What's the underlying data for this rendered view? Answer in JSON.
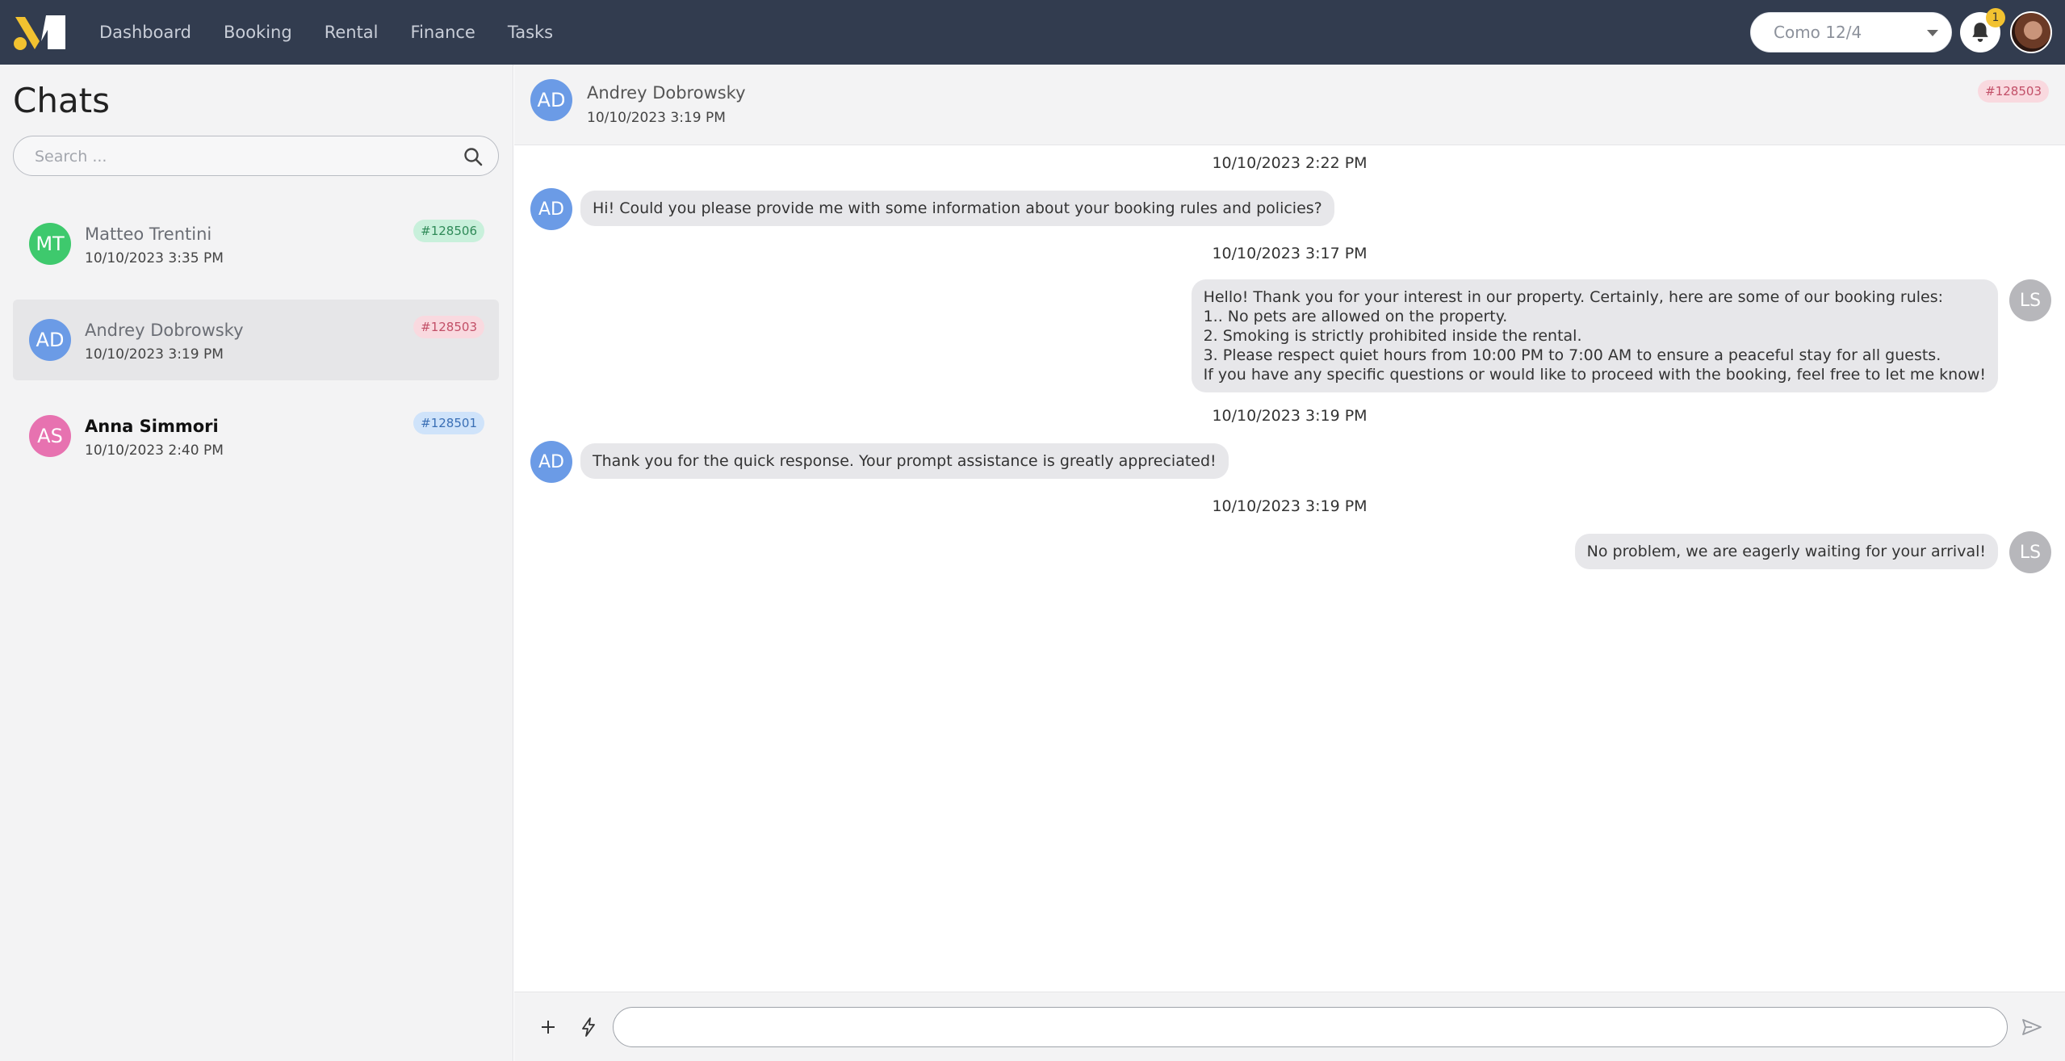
{
  "nav": {
    "items": [
      "Dashboard",
      "Booking",
      "Rental",
      "Finance",
      "Tasks"
    ]
  },
  "header_right": {
    "location_select": "Como 12/4",
    "notification_count": "1"
  },
  "sidebar": {
    "title": "Chats",
    "search_placeholder": "Search ...",
    "chats": [
      {
        "initials": "MT",
        "name": "Matteo Trentini",
        "time": "10/10/2023 3:35 PM",
        "tag": "#128506",
        "avatar_color": "#3ec96d",
        "tag_bg": "#c8f0db",
        "tag_fg": "#2f8a58",
        "active": false,
        "unread": false
      },
      {
        "initials": "AD",
        "name": "Andrey Dobrowsky",
        "time": "10/10/2023 3:19 PM",
        "tag": "#128503",
        "avatar_color": "#6b9be6",
        "tag_bg": "#f9d9df",
        "tag_fg": "#c24f67",
        "active": true,
        "unread": false
      },
      {
        "initials": "AS",
        "name": "Anna Simmori",
        "time": "10/10/2023 2:40 PM",
        "tag": "#128501",
        "avatar_color": "#e772b0",
        "tag_bg": "#cfe3fa",
        "tag_fg": "#3a6fb5",
        "active": false,
        "unread": true
      }
    ]
  },
  "chat": {
    "contact_initials": "AD",
    "contact_name": "Andrey Dobrowsky",
    "contact_time": "10/10/2023 3:19 PM",
    "contact_tag": "#128503",
    "messages": [
      {
        "timestamp": "10/10/2023 2:22 PM",
        "from": "guest",
        "initials": "AD",
        "lines": [
          "Hi! Could you please provide me with some information about your booking rules and policies?"
        ]
      },
      {
        "timestamp": "10/10/2023 3:17 PM",
        "from": "host",
        "initials": "LS",
        "lines": [
          "Hello! Thank you for your interest in our property. Certainly, here are some of our booking rules:",
          "1.. No pets are allowed on the property.",
          "2. Smoking is strictly prohibited inside the rental.",
          "3. Please respect quiet hours from 10:00 PM to 7:00 AM to ensure a peaceful stay for all guests.",
          "If you have any specific questions or would like to proceed with the booking, feel free to let me know!"
        ]
      },
      {
        "timestamp": "10/10/2023 3:19 PM",
        "from": "guest",
        "initials": "AD",
        "lines": [
          "Thank you for the quick response. Your prompt assistance is greatly appreciated!"
        ]
      },
      {
        "timestamp": "10/10/2023 3:19 PM",
        "from": "host",
        "initials": "LS",
        "lines": [
          "No problem, we are eagerly waiting for your arrival!"
        ]
      }
    ]
  },
  "composer": {
    "message_value": ""
  },
  "colors": {
    "topbar": "#323c4f",
    "brand_yellow": "#f2c230",
    "guest_avatar": "#6b9be6",
    "host_avatar": "#b7b7bb"
  },
  "icons": [
    "logo-icon",
    "bell-icon",
    "search-icon",
    "plus-icon",
    "bolt-icon",
    "send-icon",
    "chevron-down-icon"
  ]
}
